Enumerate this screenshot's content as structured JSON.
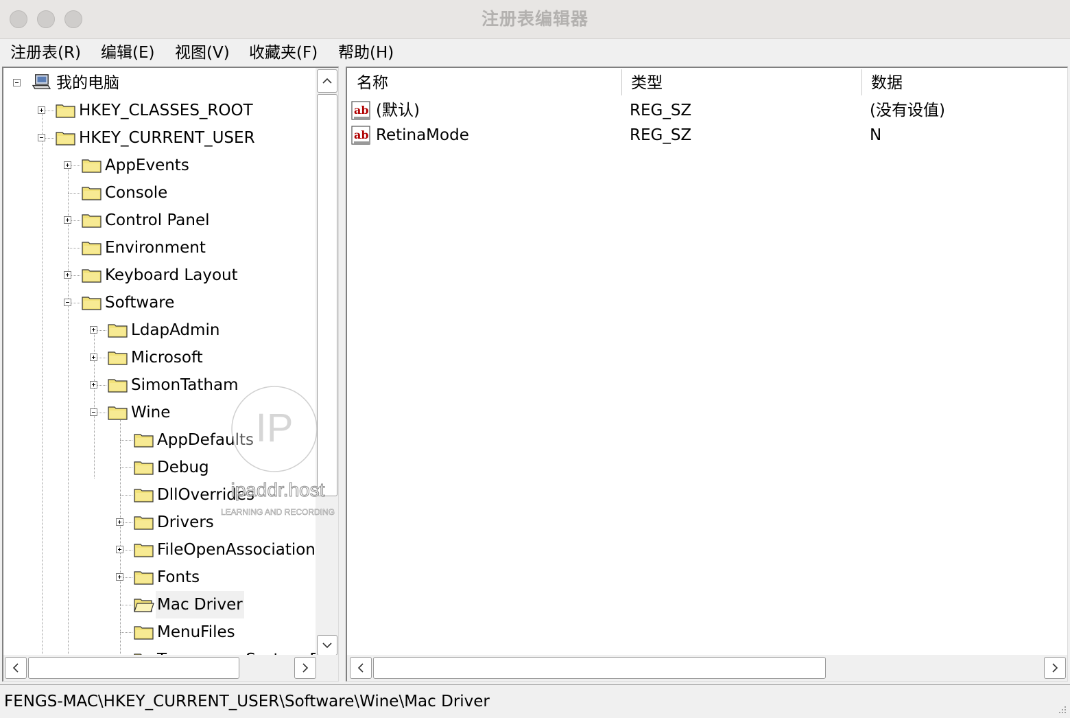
{
  "window": {
    "title": "注册表编辑器"
  },
  "menu": [
    {
      "label": "注册表(R)"
    },
    {
      "label": "编辑(E)"
    },
    {
      "label": "视图(V)"
    },
    {
      "label": "收藏夹(F)"
    },
    {
      "label": "帮助(H)"
    }
  ],
  "tree": {
    "root": "我的电脑",
    "nodes": [
      {
        "label": "HKEY_CLASSES_ROOT"
      },
      {
        "label": "HKEY_CURRENT_USER"
      },
      {
        "label": "AppEvents"
      },
      {
        "label": "Console"
      },
      {
        "label": "Control Panel"
      },
      {
        "label": "Environment"
      },
      {
        "label": "Keyboard Layout"
      },
      {
        "label": "Software"
      },
      {
        "label": "LdapAdmin"
      },
      {
        "label": "Microsoft"
      },
      {
        "label": "SimonTatham"
      },
      {
        "label": "Wine"
      },
      {
        "label": "AppDefaults"
      },
      {
        "label": "Debug"
      },
      {
        "label": "DllOverrides"
      },
      {
        "label": "Drivers"
      },
      {
        "label": "FileOpenAssociations"
      },
      {
        "label": "Fonts"
      },
      {
        "label": "Mac Driver"
      },
      {
        "label": "MenuFiles"
      },
      {
        "label": "Temporary System Files"
      }
    ],
    "selected": "Mac Driver"
  },
  "list": {
    "columns": [
      {
        "label": "名称"
      },
      {
        "label": "类型"
      },
      {
        "label": "数据"
      }
    ],
    "rows": [
      {
        "name": "(默认)",
        "type": "REG_SZ",
        "data": "(没有设值)",
        "icon": "string-value-icon"
      },
      {
        "name": "RetinaMode",
        "type": "REG_SZ",
        "data": "N",
        "icon": "string-value-icon"
      }
    ]
  },
  "status": {
    "path": "FENGS-MAC\\HKEY_CURRENT_USER\\Software\\Wine\\Mac Driver"
  },
  "watermark": {
    "logo": "IP",
    "site": "ipaddr.host",
    "tagline": "LEARNING AND RECORDING"
  },
  "colors": {
    "folder": "#f2e27a",
    "folder_outline": "#8a7a2a",
    "ab_red": "#b00000",
    "selection_bg": "#f0f0f0"
  }
}
